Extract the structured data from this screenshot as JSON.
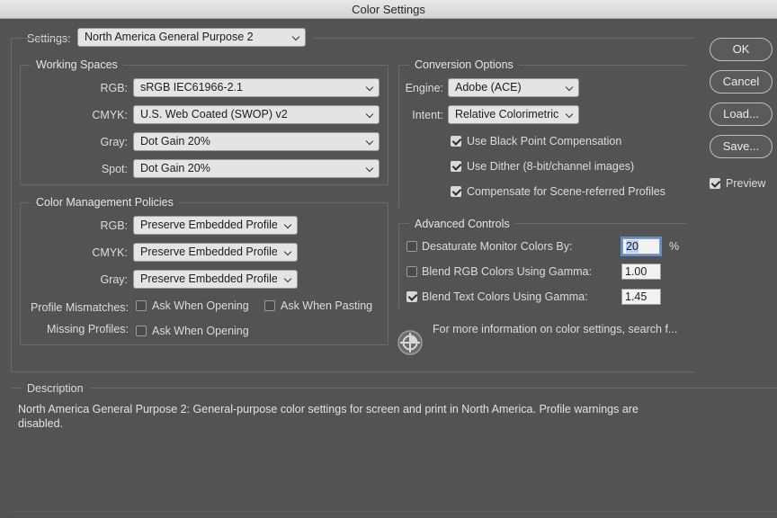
{
  "window": {
    "title": "Color Settings"
  },
  "settings": {
    "label": "Settings:",
    "value": "North America General Purpose 2"
  },
  "working_spaces": {
    "title": "Working Spaces",
    "rgb": {
      "label": "RGB:",
      "value": "sRGB IEC61966-2.1"
    },
    "cmyk": {
      "label": "CMYK:",
      "value": "U.S. Web Coated (SWOP) v2"
    },
    "gray": {
      "label": "Gray:",
      "value": "Dot Gain 20%"
    },
    "spot": {
      "label": "Spot:",
      "value": "Dot Gain 20%"
    }
  },
  "policies": {
    "title": "Color Management Policies",
    "rgb": {
      "label": "RGB:",
      "value": "Preserve Embedded Profiles"
    },
    "cmyk": {
      "label": "CMYK:",
      "value": "Preserve Embedded Profiles"
    },
    "gray": {
      "label": "Gray:",
      "value": "Preserve Embedded Profiles"
    },
    "mismatch_label": "Profile Mismatches:",
    "ask_opening": "Ask When Opening",
    "ask_pasting": "Ask When Pasting",
    "missing_label": "Missing Profiles:",
    "missing_ask_opening": "Ask When Opening"
  },
  "conversion": {
    "title": "Conversion Options",
    "engine_label": "Engine:",
    "engine_value": "Adobe (ACE)",
    "intent_label": "Intent:",
    "intent_value": "Relative Colorimetric",
    "black_point": "Use Black Point Compensation",
    "dither": "Use Dither (8-bit/channel images)",
    "scene_referred": "Compensate for Scene-referred Profiles"
  },
  "advanced": {
    "title": "Advanced Controls",
    "desaturate_label": "Desaturate Monitor Colors By:",
    "desaturate_value": "20",
    "percent": "%",
    "blend_rgb_label": "Blend RGB Colors Using Gamma:",
    "blend_rgb_value": "1.00",
    "blend_text_label": "Blend Text Colors Using Gamma:",
    "blend_text_value": "1.45"
  },
  "info": {
    "text": "For more information on color settings, search f..."
  },
  "buttons": {
    "ok": "OK",
    "cancel": "Cancel",
    "load": "Load...",
    "save": "Save...",
    "preview": "Preview"
  },
  "description": {
    "title": "Description",
    "text": "North America General Purpose 2:  General-purpose color settings for screen and print in North America. Profile warnings are disabled."
  }
}
